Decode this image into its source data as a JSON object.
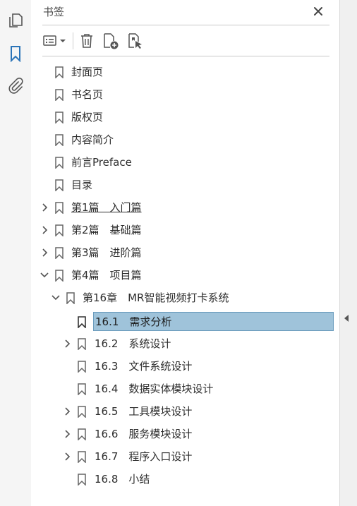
{
  "panel": {
    "title": "书签",
    "close_label": "✕"
  },
  "rail": {
    "items": [
      {
        "name": "pages-icon"
      },
      {
        "name": "bookmark-icon",
        "active": true
      },
      {
        "name": "attachment-icon"
      }
    ]
  },
  "toolbar": {
    "items": [
      "options-menu-icon",
      "delete-icon",
      "new-bookmark-icon",
      "new-bookmark-from-structure-icon"
    ]
  },
  "bookmarks": [
    {
      "label": "封面页"
    },
    {
      "label": "书名页"
    },
    {
      "label": "版权页"
    },
    {
      "label": "内容简介"
    },
    {
      "label": "前言Preface"
    },
    {
      "label": "目录"
    },
    {
      "label": "第1篇　入门篇",
      "expander": "collapsed"
    },
    {
      "label": "第2篇　基础篇",
      "expander": "collapsed"
    },
    {
      "label": "第3篇　进阶篇",
      "expander": "collapsed"
    },
    {
      "label": "第4篇　项目篇",
      "expander": "expanded"
    },
    {
      "label": "第16章　MR智能视频打卡系统",
      "expander": "expanded"
    },
    {
      "label": "16.1　需求分析",
      "selected": true
    },
    {
      "label": "16.2　系统设计",
      "expander": "collapsed"
    },
    {
      "label": "16.3　文件系统设计"
    },
    {
      "label": "16.4　数据实体模块设计"
    },
    {
      "label": "16.5　工具模块设计",
      "expander": "collapsed"
    },
    {
      "label": "16.6　服务模块设计",
      "expander": "collapsed"
    },
    {
      "label": "16.7　程序入口设计",
      "expander": "collapsed"
    },
    {
      "label": "16.8　小结"
    }
  ],
  "colors": {
    "accent": "#2b74b8",
    "selected_bg": "#9fc3da",
    "selected_border": "#6b9cbd"
  }
}
